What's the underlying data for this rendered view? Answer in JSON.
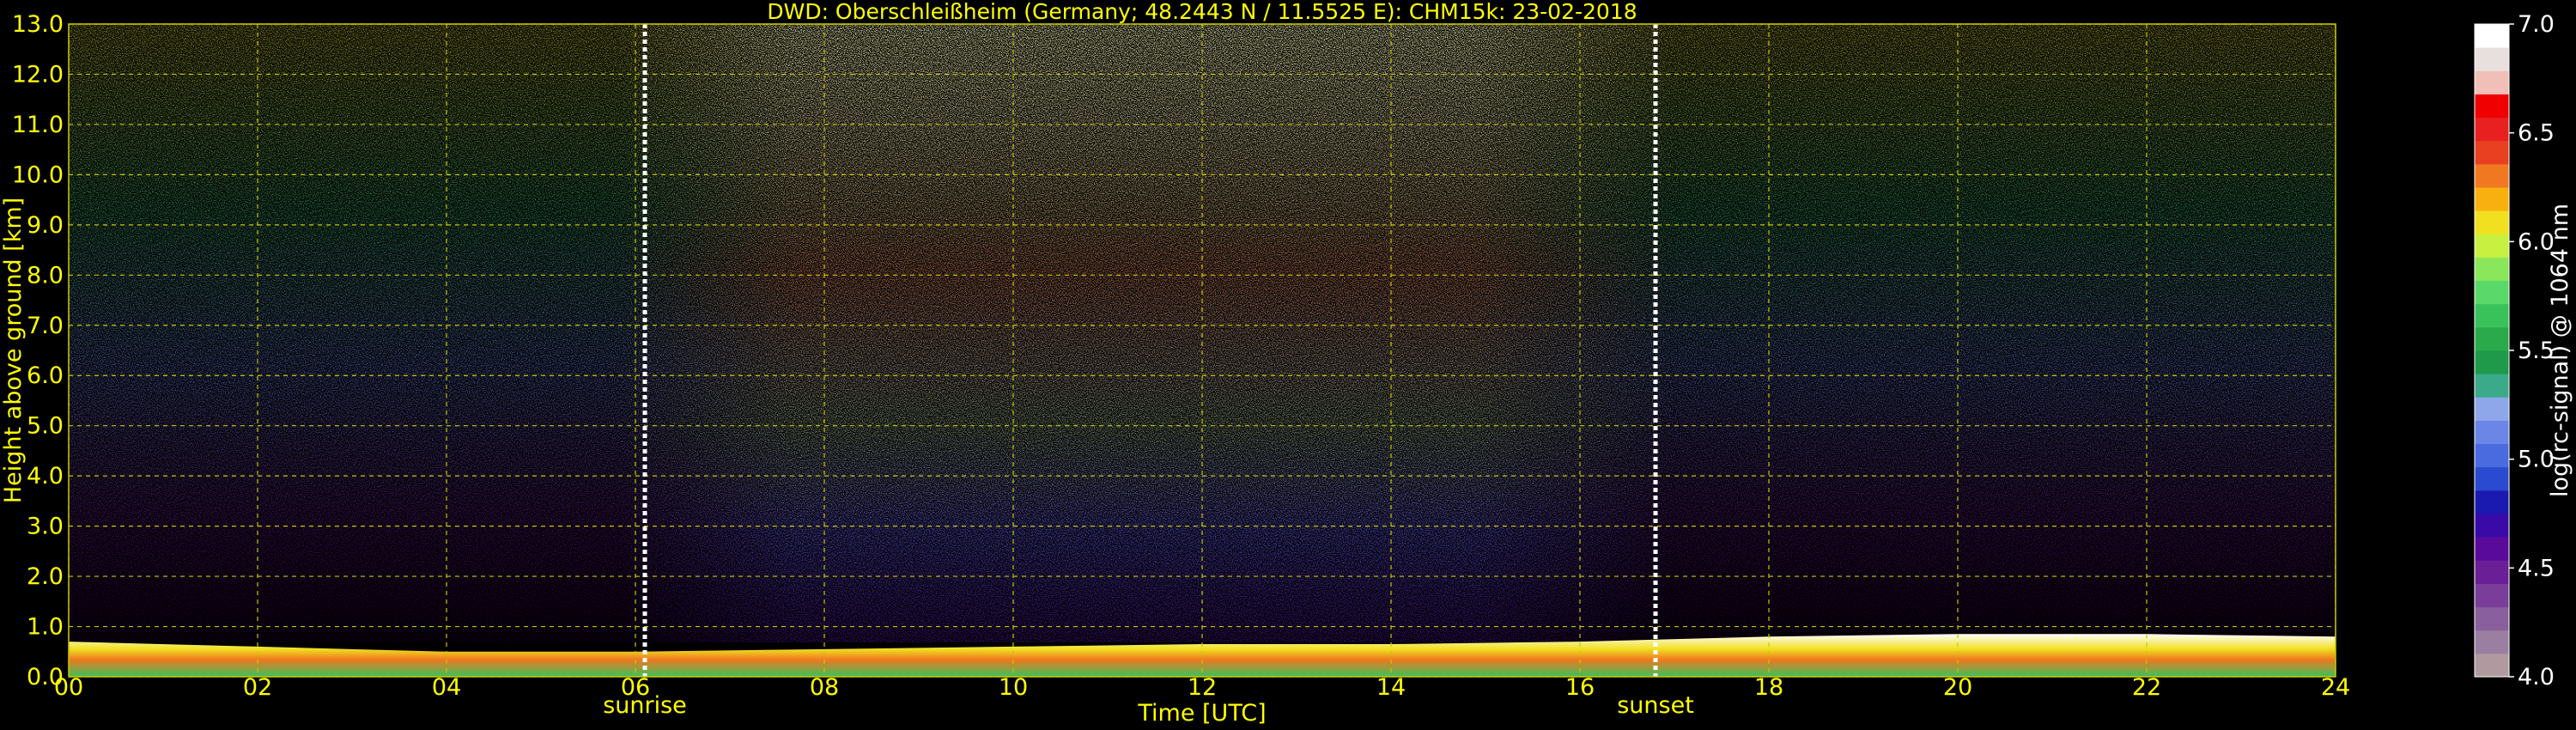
{
  "chart_data": {
    "type": "heatmap",
    "title": "DWD: Oberschleißheim (Germany; 48.2443 N / 11.5525 E):    CHM15k: 23-02-2018",
    "xlabel": "Time [UTC]",
    "ylabel": "Height above ground [km]",
    "xlim": [
      0,
      24
    ],
    "ylim": [
      0,
      13
    ],
    "x_ticks": [
      "00",
      "02",
      "04",
      "06",
      "08",
      "10",
      "12",
      "14",
      "16",
      "18",
      "20",
      "22",
      "24"
    ],
    "y_ticks": [
      "0.0",
      "1.0",
      "2.0",
      "3.0",
      "4.0",
      "5.0",
      "6.0",
      "7.0",
      "8.0",
      "9.0",
      "10.0",
      "11.0",
      "12.0",
      "13.0"
    ],
    "grid": true,
    "annotations": [
      {
        "label": "sunrise",
        "x": 6.1
      },
      {
        "label": "sunset",
        "x": 16.8
      }
    ],
    "boundary_layer_top_km": [
      {
        "x": 0,
        "y": 0.7
      },
      {
        "x": 2,
        "y": 0.6
      },
      {
        "x": 4,
        "y": 0.5
      },
      {
        "x": 6,
        "y": 0.5
      },
      {
        "x": 8,
        "y": 0.55
      },
      {
        "x": 10,
        "y": 0.6
      },
      {
        "x": 12,
        "y": 0.65
      },
      {
        "x": 14,
        "y": 0.65
      },
      {
        "x": 16,
        "y": 0.7
      },
      {
        "x": 18,
        "y": 0.8
      },
      {
        "x": 20,
        "y": 0.85
      },
      {
        "x": 22,
        "y": 0.85
      },
      {
        "x": 24,
        "y": 0.8
      }
    ],
    "background_signal_by_hour": [
      {
        "x": 0,
        "level": 5.2
      },
      {
        "x": 6,
        "level": 5.2
      },
      {
        "x": 8,
        "level": 5.9
      },
      {
        "x": 12,
        "level": 6.4
      },
      {
        "x": 16,
        "level": 6.0
      },
      {
        "x": 18,
        "level": 5.2
      },
      {
        "x": 24,
        "level": 5.2
      }
    ],
    "colorbar": {
      "label": "log(rc-signal) @ 1064 nm",
      "range": [
        4.0,
        7.0
      ],
      "ticks": [
        "4.0",
        "4.5",
        "5.0",
        "5.5",
        "6.0",
        "6.5",
        "7.0"
      ],
      "colors": [
        "#b09aa0",
        "#9a7fa0",
        "#8a5f9e",
        "#7a3d99",
        "#6a1f96",
        "#5a0a9a",
        "#3a0aa8",
        "#1a1ab0",
        "#2a4ad0",
        "#4a6ae0",
        "#6a86e6",
        "#8ea6ea",
        "#3aaa8a",
        "#1e9a4a",
        "#2aaa4a",
        "#3ac25a",
        "#5ad86a",
        "#8ae65a",
        "#c8f040",
        "#f0e020",
        "#f8b010",
        "#f07820",
        "#e84020",
        "#e82020",
        "#f00000",
        "#f0c0b8",
        "#e8e0dc",
        "#ffffff"
      ]
    }
  }
}
